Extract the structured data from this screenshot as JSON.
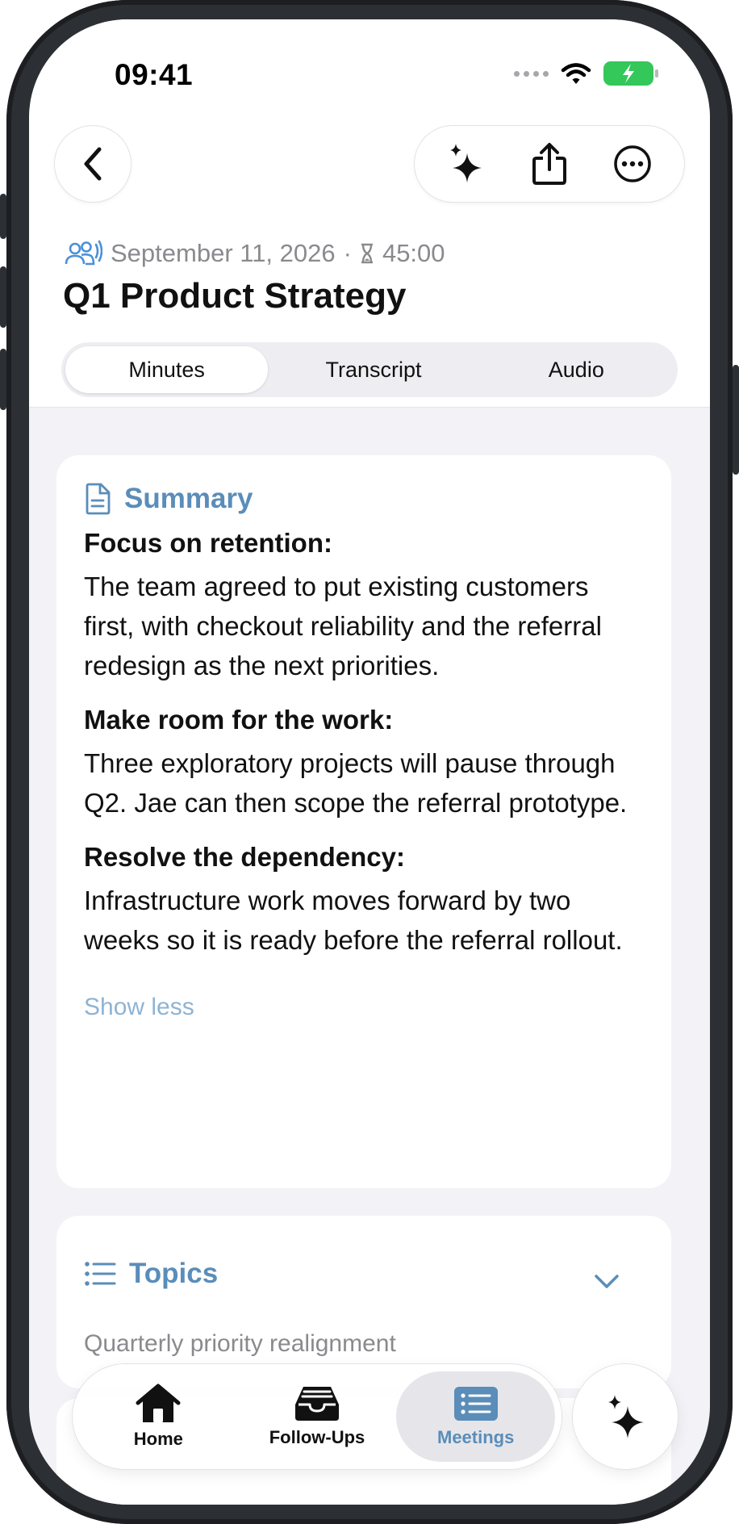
{
  "status": {
    "time": "09:41"
  },
  "meeting": {
    "date": "September 11, 2026",
    "duration": "45:00",
    "title": "Q1 Product Strategy"
  },
  "tabs": [
    {
      "label": "Minutes"
    },
    {
      "label": "Transcript"
    },
    {
      "label": "Audio"
    }
  ],
  "summary": {
    "heading": "Summary",
    "sections": [
      {
        "title": "Focus on retention:",
        "body": "The team agreed to put existing customers first, with checkout reliability and the referral redesign as the next priorities."
      },
      {
        "title": "Make room for the work:",
        "body": "Three exploratory projects will pause through Q2. Jae can then scope the referral prototype."
      },
      {
        "title": "Resolve the dependency:",
        "body": "Infrastructure work moves forward by two weeks so it is ready before the referral rollout."
      }
    ],
    "show_less": "Show less"
  },
  "topics": {
    "heading": "Topics",
    "first_item": "Quarterly priority realignment"
  },
  "tabbar": {
    "items": [
      {
        "label": "Home",
        "icon": "house-icon"
      },
      {
        "label": "Follow-Ups",
        "icon": "inbox-tray-icon"
      },
      {
        "label": "Meetings",
        "icon": "list-icon"
      }
    ]
  },
  "colors": {
    "accent": "#5a8db9",
    "battery": "#34c759",
    "background": "#f2f2f7"
  }
}
